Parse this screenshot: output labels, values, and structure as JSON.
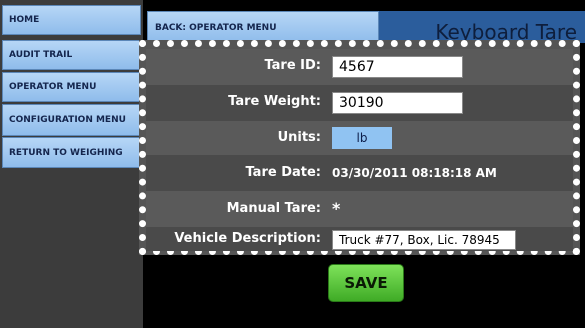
{
  "sidebar": {
    "items": [
      {
        "label": "HOME"
      },
      {
        "label": "AUDIT TRAIL"
      },
      {
        "label": "OPERATOR MENU"
      },
      {
        "label": "CONFIGURATION MENU"
      },
      {
        "label": "RETURN TO WEIGHING"
      }
    ]
  },
  "header": {
    "back_label": "BACK: OPERATOR MENU",
    "title": "Keyboard Tare"
  },
  "form": {
    "tare_id_label": "Tare ID:",
    "tare_id_value": "4567",
    "tare_weight_label": "Tare Weight:",
    "tare_weight_value": "30190",
    "units_label": "Units:",
    "units_value": "lb",
    "tare_date_label": "Tare Date:",
    "tare_date_value": "03/30/2011 08:18:18 AM",
    "manual_tare_label": "Manual Tare:",
    "manual_tare_value": "*",
    "vehicle_label": "Vehicle Description:",
    "vehicle_value": "Truck #77, Box, Lic. 78945"
  },
  "actions": {
    "save_label": "SAVE"
  },
  "colors": {
    "accent_blue": "#8fbceb",
    "title_bar": "#2b5d9c",
    "save_green": "#3fab26"
  }
}
